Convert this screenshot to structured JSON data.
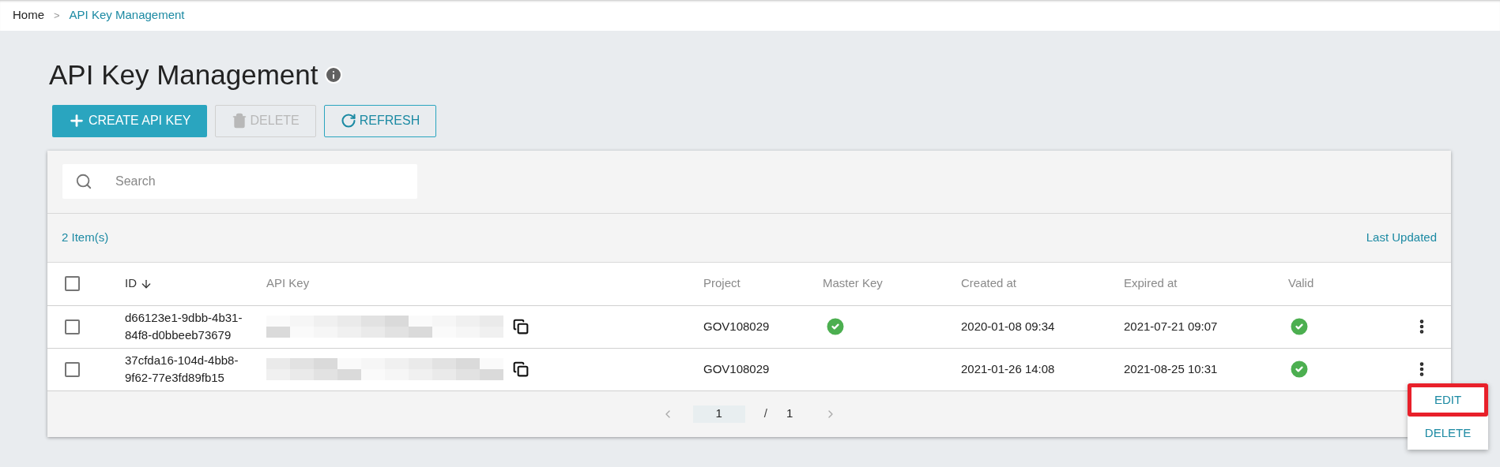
{
  "breadcrumb": [
    {
      "label": "Home",
      "current": false
    },
    {
      "label": "API Key Management",
      "current": true
    }
  ],
  "breadcrumb_separator": ">",
  "title": "API Key Management",
  "toolbar": [
    {
      "kind": "create",
      "label": "CREATE API KEY",
      "disabled": false
    },
    {
      "kind": "delete",
      "label": "DELETE",
      "disabled": true
    },
    {
      "kind": "refresh",
      "label": "REFRESH",
      "disabled": false
    }
  ],
  "search": {
    "placeholder": "Search"
  },
  "item_count": "2 Item(s)",
  "last_updated": "Last Updated",
  "table": {
    "columns": [
      "ID",
      "API Key",
      "Project",
      "Master Key",
      "Created at",
      "Expired at",
      "Valid"
    ],
    "select_all_checked": false,
    "rows": [
      {
        "checked": false,
        "id": "d66123e1-9dbb-4b31-84f8-d0bbeeb73679",
        "project": "GOV108029",
        "master_key": true,
        "created_at": "2020-01-08 09:34",
        "expired_at": "2021-07-21 09:07",
        "valid": true
      },
      {
        "checked": false,
        "id": "37cfda16-104d-4bb8-9f62-77e3fd89fb15",
        "project": "GOV108029",
        "master_key": false,
        "created_at": "2021-01-26 14:08",
        "expired_at": "2021-08-25 10:31",
        "valid": true
      }
    ]
  },
  "pagination": {
    "page": "1",
    "separator": "/",
    "total": "1"
  },
  "row_menu": [
    {
      "label": "EDIT",
      "highlighted": true
    },
    {
      "label": "DELETE",
      "highlighted": false
    }
  ]
}
